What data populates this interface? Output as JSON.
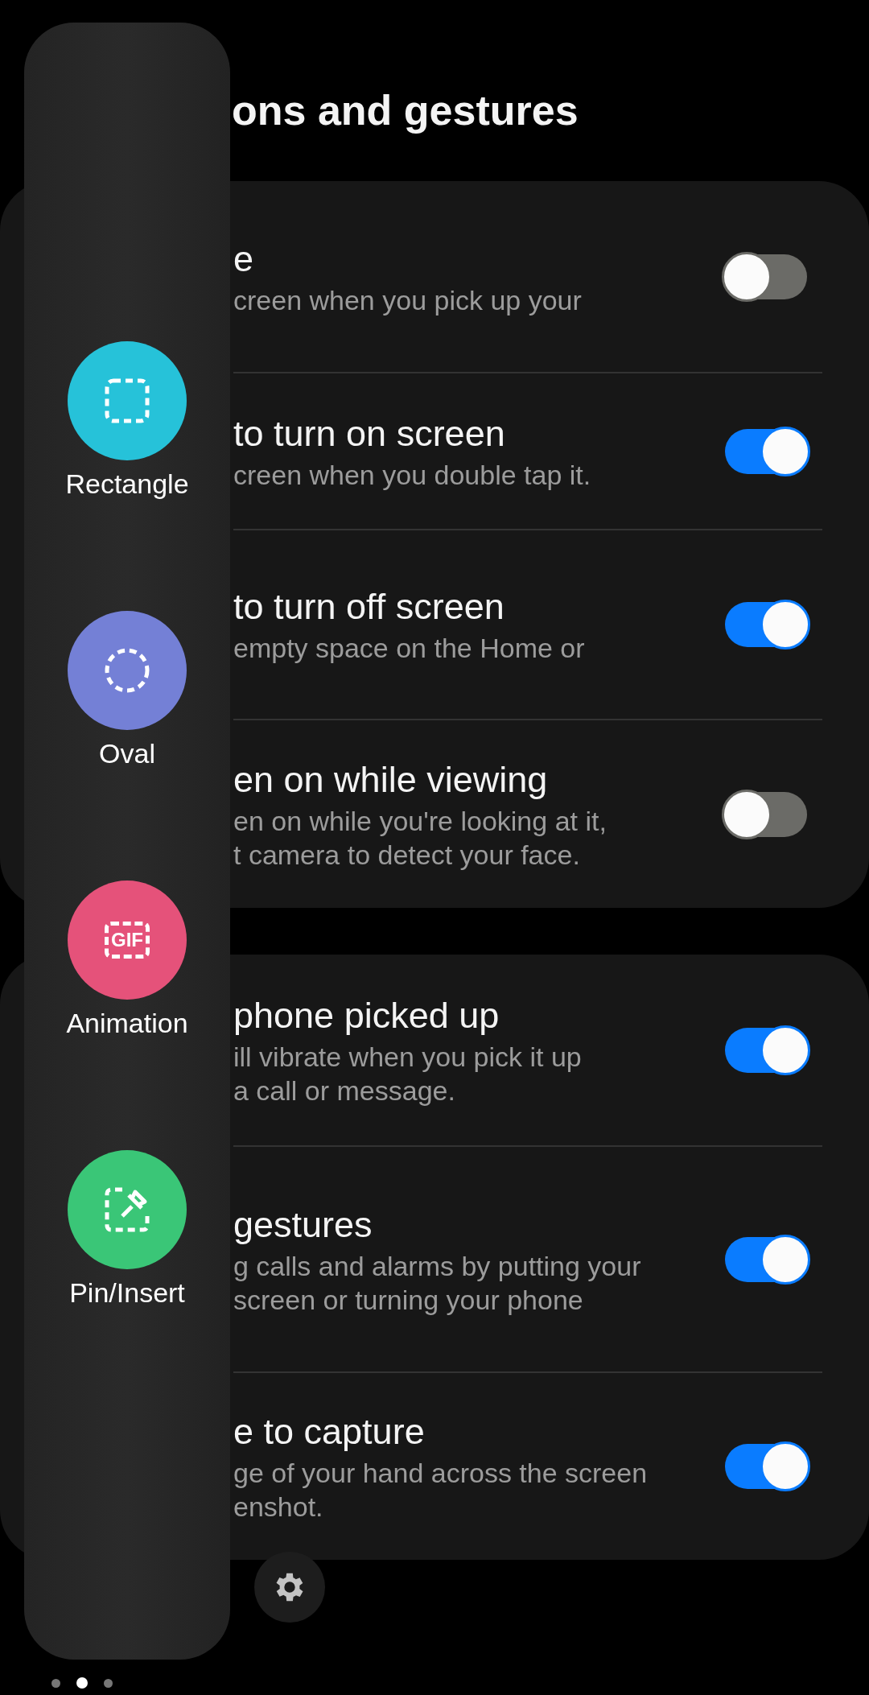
{
  "title": "ons and gestures",
  "cards": [
    {
      "rows": [
        {
          "title": "e",
          "description": "creen when you pick up your",
          "on": false
        },
        {
          "title": "to turn on screen",
          "description": "creen when you double tap it.",
          "on": true
        },
        {
          "title": "to turn off screen",
          "description": "empty space on the Home or",
          "on": true
        },
        {
          "title": "en on while viewing",
          "description": "en on while you're looking at it,\nt camera to detect your face.",
          "on": false
        }
      ]
    },
    {
      "rows": [
        {
          "title": "phone picked up",
          "description": "ill vibrate when you pick it up\na call or message.",
          "on": true
        },
        {
          "title": "gestures",
          "description": "g calls and alarms by putting your\nscreen or turning your phone",
          "on": true
        },
        {
          "title": "e to capture",
          "description": "ge of your hand across the screen\nenshot.",
          "on": true
        }
      ]
    }
  ],
  "panel": {
    "items": [
      {
        "kind": "rectangle",
        "label": "Rectangle",
        "color": "#26c2d9"
      },
      {
        "kind": "oval",
        "label": "Oval",
        "color": "#7480d6"
      },
      {
        "kind": "gif",
        "label": "Animation",
        "color": "#e5527a",
        "icon_text": "GIF"
      },
      {
        "kind": "pin",
        "label": "Pin/Insert",
        "color": "#3ac677"
      }
    ]
  },
  "page_dots": [
    {
      "selected": false
    },
    {
      "selected": true
    },
    {
      "selected": false
    }
  ]
}
